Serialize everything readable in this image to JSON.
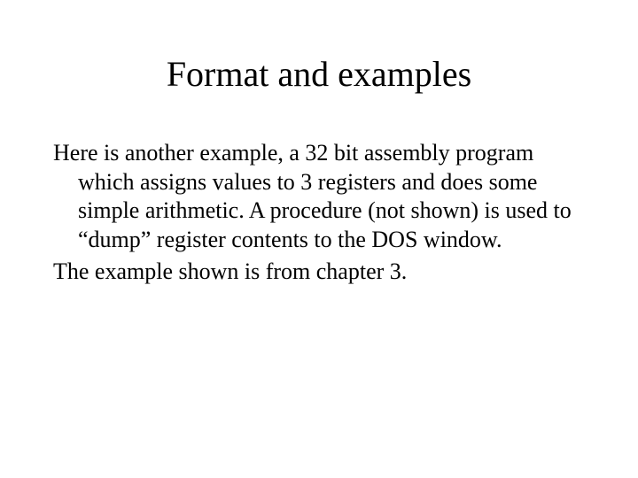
{
  "title": "Format and examples",
  "para1": "Here is another example, a 32 bit assembly program which assigns values to 3 registers and does some simple arithmetic.  A procedure (not shown) is used to “dump” register contents to the DOS window.",
  "para2": "The example shown is from chapter 3."
}
